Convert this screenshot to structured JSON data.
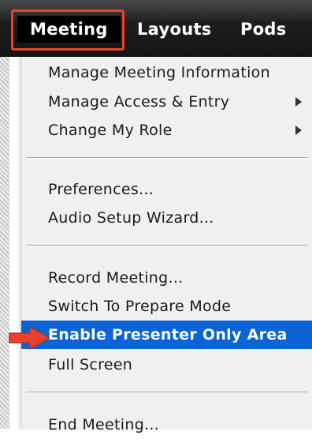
{
  "menubar": {
    "items": [
      {
        "label": "Meeting"
      },
      {
        "label": "Layouts"
      },
      {
        "label": "Pods"
      }
    ]
  },
  "menu": {
    "manage_meeting_information": "Manage Meeting Information",
    "manage_access_entry": "Manage Access & Entry",
    "change_my_role": "Change My Role",
    "preferences": "Preferences...",
    "audio_setup_wizard": "Audio Setup Wizard...",
    "record_meeting": "Record Meeting...",
    "switch_to_prepare_mode": "Switch To Prepare Mode",
    "enable_presenter_only_area": "Enable Presenter Only Area",
    "full_screen": "Full Screen",
    "end_meeting": "End Meeting..."
  },
  "colors": {
    "menubar_bg": "#1e1e1e",
    "selected_item_bg": "#0b64d6",
    "annotation_red": "#e8412c"
  },
  "icons": {
    "submenu": "chevron-right-icon",
    "annotation": "arrow-pointer-icon"
  }
}
